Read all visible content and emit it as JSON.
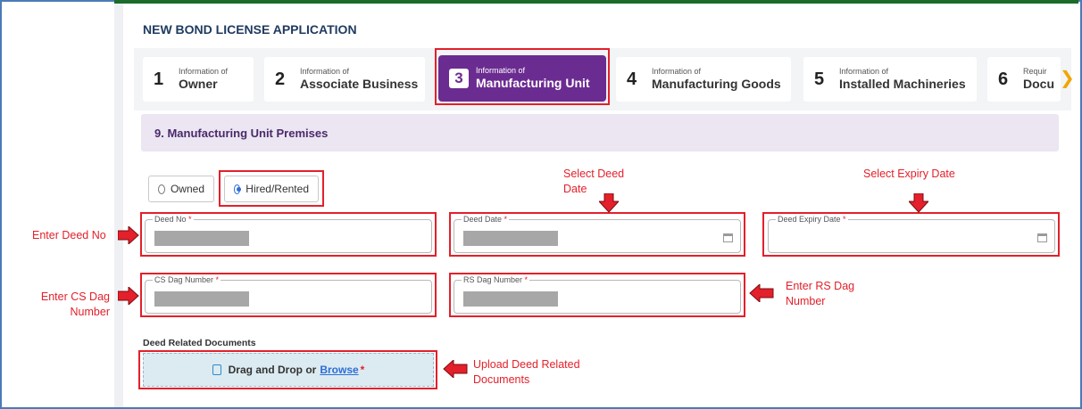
{
  "header": {
    "title": "NEW BOND LICENSE APPLICATION"
  },
  "steps": [
    {
      "num": "1",
      "small": "Information of",
      "big": "Owner"
    },
    {
      "num": "2",
      "small": "Information of",
      "big": "Associate Business"
    },
    {
      "num": "3",
      "small": "Information of",
      "big": "Manufacturing Unit",
      "active": true
    },
    {
      "num": "4",
      "small": "Information of",
      "big": "Manufacturing Goods"
    },
    {
      "num": "5",
      "small": "Information of",
      "big": "Installed Machineries"
    },
    {
      "num": "6",
      "small": "Requir",
      "big": "Docu"
    }
  ],
  "section": {
    "title": "9. Manufacturing Unit Premises"
  },
  "radios": {
    "owned": "Owned",
    "hired": "Hired/Rented",
    "selected": "Hired/Rented"
  },
  "fields": {
    "deed_no": "Deed No",
    "deed_date": "Deed Date",
    "deed_expiry": "Deed Expiry Date",
    "cs_dag": "CS Dag Number",
    "rs_dag": "RS Dag Number"
  },
  "docs": {
    "label": "Deed Related Documents",
    "drag_text": "Drag and Drop or",
    "browse": "Browse"
  },
  "annotations": {
    "select_deed_date_1": "Select Deed",
    "select_deed_date_2": "Date",
    "select_expiry": "Select Expiry Date",
    "enter_deed_no": "Enter Deed No",
    "enter_cs_1": "Enter CS Dag",
    "enter_cs_2": "Number",
    "enter_rs_1": "Enter RS Dag",
    "enter_rs_2": "Number",
    "upload_1": "Upload Deed Related",
    "upload_2": "Documents"
  },
  "colors": {
    "accent": "#6b2c91",
    "annotation": "#e3202b",
    "link": "#2c6dd6"
  }
}
